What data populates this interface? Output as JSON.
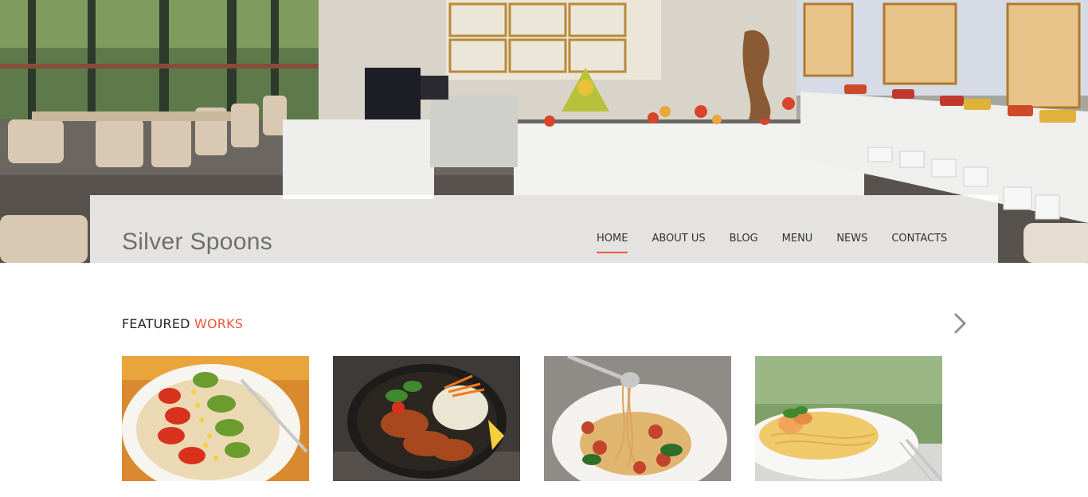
{
  "header": {
    "brand": "Silver Spoons",
    "nav": [
      {
        "label": "HOME",
        "active": true
      },
      {
        "label": "ABOUT US",
        "active": false
      },
      {
        "label": "BLOG",
        "active": false
      },
      {
        "label": "MENU",
        "active": false
      },
      {
        "label": "NEWS",
        "active": false
      },
      {
        "label": "CONTACTS",
        "active": false
      }
    ],
    "accent_color": "#e8583a"
  },
  "featured": {
    "title_part1": "FEATURED",
    "title_part2": "WORKS",
    "next_icon": "chevron-right-icon",
    "items": [
      {
        "image": "avocado-tomato-salad-photo"
      },
      {
        "image": "glazed-chicken-bowl-photo"
      },
      {
        "image": "spaghetti-on-fork-photo"
      },
      {
        "image": "pasta-with-shrimp-photo"
      }
    ]
  }
}
